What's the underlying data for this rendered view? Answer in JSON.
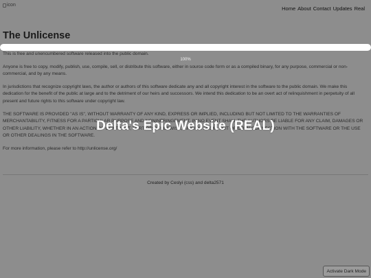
{
  "header": {
    "logo_alt": "icon",
    "nav": [
      "Home",
      "About",
      "Contact",
      "Updates",
      "Real"
    ]
  },
  "page": {
    "title": "The Unlicense",
    "progress_label": "100%",
    "progress": 1.0,
    "paragraphs": [
      "This is free and unencumbered software released into the public domain.",
      "Anyone is free to copy, modify, publish, use, compile, sell, or distribute this software, either in source code form or as a compiled binary, for any purpose, commercial or non-commercial, and by any means.",
      "In jurisdictions that recognize copyright laws, the author or authors of this software dedicate any and all copyright interest in the software to the public domain. We make this dedication for the benefit of the public at large and to the detriment of our heirs and successors. We intend this dedication to be an overt act of relinquishment in perpetuity of all present and future rights to this software under copyright law.",
      "THE SOFTWARE IS PROVIDED \"AS IS\", WITHOUT WARRANTY OF ANY KIND, EXPRESS OR IMPLIED, INCLUDING BUT NOT LIMITED TO THE WARRANTIES OF MERCHANTABILITY, FITNESS FOR A PARTICULAR PURPOSE AND NONINFRINGEMENT. IN NO EVENT SHALL THE AUTHORS BE LIABLE FOR ANY CLAIM, DAMAGES OR OTHER LIABILITY, WHETHER IN AN ACTION OF CONTRACT, TORT OR OTHERWISE, ARISING FROM, OUT OF OR IN CONNECTION WITH THE SOFTWARE OR THE USE OR OTHER DEALINGS IN THE SOFTWARE.",
      "For more information, please refer to http://unlicense.org/"
    ],
    "banner": "Delta's Epic Website (REAL)"
  },
  "footer": {
    "credit": "Created by Ceslyi (css) and delta2571"
  },
  "controls": {
    "dark_mode_label": "Activate Dark Mode"
  },
  "colors": {
    "overlay": "#8d8d8d",
    "loader": "#ffffff"
  }
}
